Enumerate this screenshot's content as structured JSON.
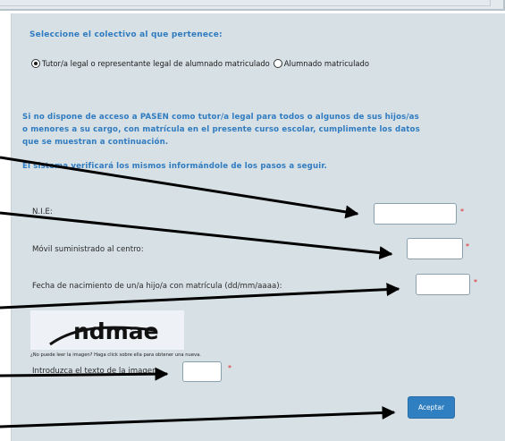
{
  "colectivo": {
    "heading": "Seleccione el colectivo al que pertenece:",
    "options": [
      {
        "label": "Tutor/a legal o representante legal de alumnado matriculado",
        "selected": true
      },
      {
        "label": "Alumnado matriculado",
        "selected": false
      }
    ]
  },
  "info": {
    "lines": [
      "Si no dispone de acceso a PASEN como tutor/a legal para todos o algunos de sus hijos/as",
      "o menores a su cargo, con matrícula en el presente curso escolar, cumplimente los datos",
      "que se muestran a continuación."
    ],
    "verify": "El sistema verificará los mismos informándole de los pasos a seguir."
  },
  "fields": {
    "nie": {
      "label": "N.I.E:",
      "value": ""
    },
    "movil": {
      "label": "Móvil suministrado al centro:",
      "value": ""
    },
    "fecha": {
      "label": "Fecha de nacimiento de un/a hijo/a con matrícula (dd/mm/aaaa):",
      "value": ""
    },
    "required_mark": "*"
  },
  "captcha": {
    "image_text": "ndmae",
    "hint": "¿No puede leer la imagen? Haga click sobre ella para obtener una nueva.",
    "prompt": "Introduzca el texto de la imagen:",
    "value": ""
  },
  "submit_label": "Aceptar",
  "colors": {
    "accent_blue": "#2f7bc0",
    "panel_bg": "#d7e0e5",
    "required_red": "#e02020",
    "arrow": "#000000"
  }
}
